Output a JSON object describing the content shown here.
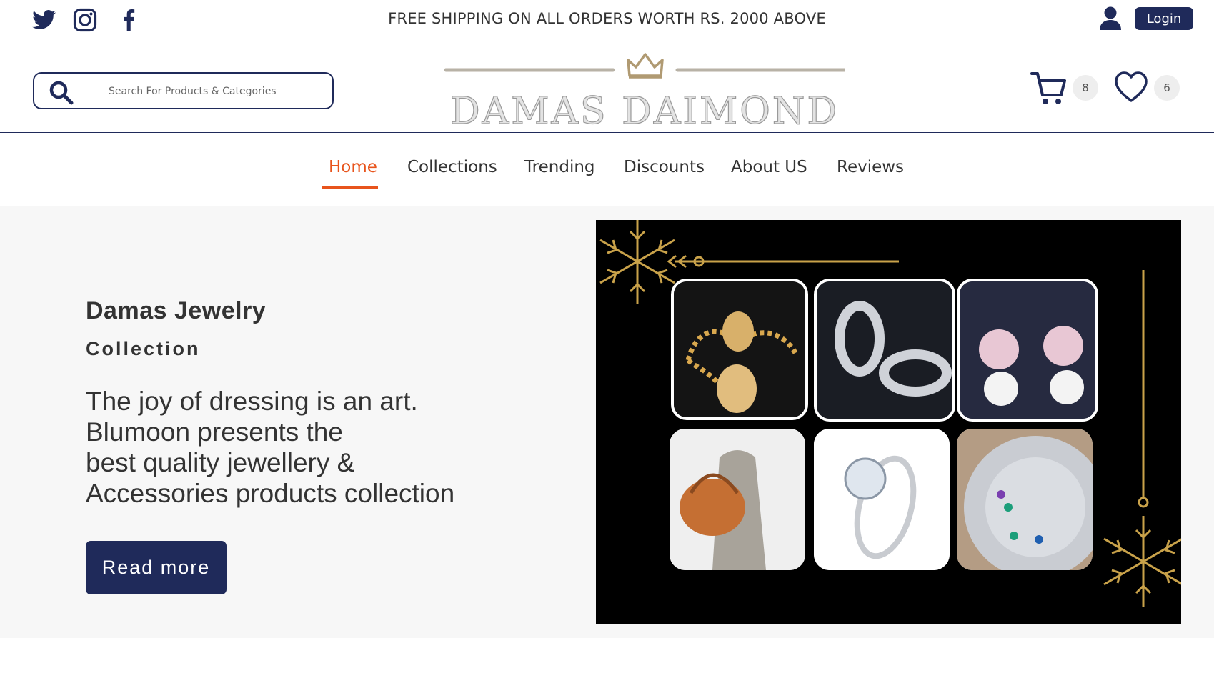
{
  "topbar": {
    "social": [
      "twitter-icon",
      "instagram-icon",
      "facebook-icon"
    ],
    "promo": "FREE SHIPPING ON ALL ORDERS WORTH RS. 2000 ABOVE",
    "login_label": "Login"
  },
  "header": {
    "search_placeholder": "Search For Products & Categories",
    "logo_text": "DAMAS DAIMOND",
    "cart_count": "8",
    "wishlist_count": "6"
  },
  "nav": {
    "items": [
      {
        "label": "Home",
        "active": true
      },
      {
        "label": "Collections"
      },
      {
        "label": "Trending"
      },
      {
        "label": "Discounts"
      },
      {
        "label": "About US"
      },
      {
        "label": "Reviews"
      }
    ]
  },
  "hero": {
    "title": "Damas Jewelry",
    "subtitle": "Collection",
    "body_lines": [
      "The joy of dressing is an art.",
      "Blumoon presents the",
      "best quality jewellery &",
      "Accessories products collection"
    ],
    "button_label": "Read more"
  },
  "colors": {
    "navy": "#1f2a5a",
    "accent": "#e8541c",
    "gold": "#c9a24a"
  }
}
